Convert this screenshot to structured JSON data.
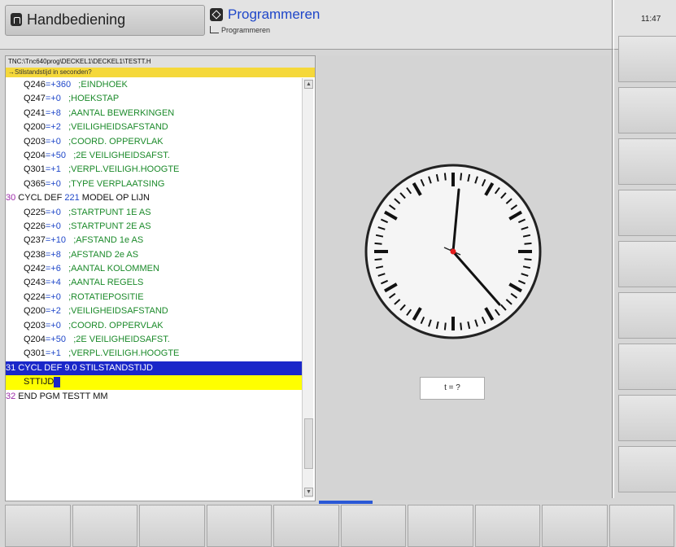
{
  "header": {
    "mode_left": "Handbediening",
    "mode_right_title": "Programmeren",
    "mode_right_sub": "Programmeren",
    "time": "11:47"
  },
  "editor": {
    "path": "TNC:\\Tnc640prog\\DECKEL1\\DECKEL1\\TESTT.H",
    "prompt": "→Stilstandstijd in seconden?",
    "lines": [
      {
        "q": "Q246",
        "v": "=+360",
        "c": ";EINDHOEK"
      },
      {
        "q": "Q247",
        "v": "=+0",
        "c": ";HOEKSTAP"
      },
      {
        "q": "Q241",
        "v": "=+8",
        "c": ";AANTAL BEWERKINGEN"
      },
      {
        "q": "Q200",
        "v": "=+2",
        "c": ";VEILIGHEIDSAFSTAND"
      },
      {
        "q": "Q203",
        "v": "=+0",
        "c": ";COORD. OPPERVLAK"
      },
      {
        "q": "Q204",
        "v": "=+50",
        "c": ";2E VEILIGHEIDSAFST."
      },
      {
        "q": "Q301",
        "v": "=+1",
        "c": ";VERPL.VEILIGH.HOOGTE"
      },
      {
        "q": "Q365",
        "v": "=+0",
        "c": ";TYPE VERPLAATSING"
      }
    ],
    "cycle30": {
      "num": "30",
      "pre": " CYCL DEF ",
      "id": "221",
      "post": " MODEL OP LIJN"
    },
    "lines2": [
      {
        "q": "Q225",
        "v": "=+0",
        "c": ";STARTPUNT 1E AS"
      },
      {
        "q": "Q226",
        "v": "=+0",
        "c": ";STARTPUNT 2E AS"
      },
      {
        "q": "Q237",
        "v": "=+10",
        "c": ";AFSTAND 1e AS"
      },
      {
        "q": "Q238",
        "v": "=+8",
        "c": ";AFSTAND 2e AS"
      },
      {
        "q": "Q242",
        "v": "=+6",
        "c": ";AANTAL KOLOMMEN"
      },
      {
        "q": "Q243",
        "v": "=+4",
        "c": ";AANTAL REGELS"
      },
      {
        "q": "Q224",
        "v": "=+0",
        "c": ";ROTATIEPOSITIE"
      },
      {
        "q": "Q200",
        "v": "=+2",
        "c": ";VEILIGHEIDSAFSTAND"
      },
      {
        "q": "Q203",
        "v": "=+0",
        "c": ";COORD. OPPERVLAK"
      },
      {
        "q": "Q204",
        "v": "=+50",
        "c": ";2E VEILIGHEIDSAFST."
      },
      {
        "q": "Q301",
        "v": "=+1",
        "c": ";VERPL.VEILIGH.HOOGTE"
      }
    ],
    "cycle31": "31 CYCL DEF 9.0 STILSTANDSTIJD",
    "sttijd": "STTIJD",
    "end_num": "32",
    "end_text": " END PGM TESTT MM"
  },
  "graphic": {
    "t_label": "t  =  ?"
  },
  "colors": {
    "selection": "#1a27c9",
    "input_highlight": "#ffff00",
    "prompt_bar": "#f5d83a",
    "comment": "#1b8a2a",
    "value": "#1f47c9",
    "block_number": "#9b2aa8"
  }
}
